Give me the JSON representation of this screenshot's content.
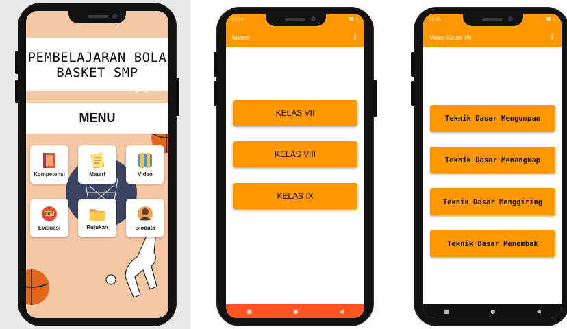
{
  "phone1": {
    "title": "PEMBELAJARAN BOLA\nBASKET SMP",
    "menu_heading": "MENU",
    "tiles": [
      {
        "label": "Kompetensi",
        "icon": "book-icon"
      },
      {
        "label": "Materi",
        "icon": "notes-icon"
      },
      {
        "label": "Video",
        "icon": "video-icon"
      },
      {
        "label": "Evaluasi",
        "icon": "quiz-icon"
      },
      {
        "label": "Rujukan",
        "icon": "folder-icon"
      },
      {
        "label": "Biodata",
        "icon": "profile-icon"
      }
    ]
  },
  "phone2": {
    "status_time": "11:34",
    "title": "Materi",
    "buttons": [
      "KELAS VII",
      "KELAS VIII",
      "KELAS IX"
    ]
  },
  "phone3": {
    "status_time": "11:35",
    "title": "Video Kelas VII",
    "buttons": [
      "Teknik Dasar Mengumpan",
      "Teknik Dasar Menangkap",
      "Teknik Dasar Menggiring",
      "Teknik Dasar Menembak"
    ]
  },
  "colors": {
    "accent": "#ff9800",
    "navbar": "#ff5722",
    "menu_bg": "#f6c7a4"
  }
}
